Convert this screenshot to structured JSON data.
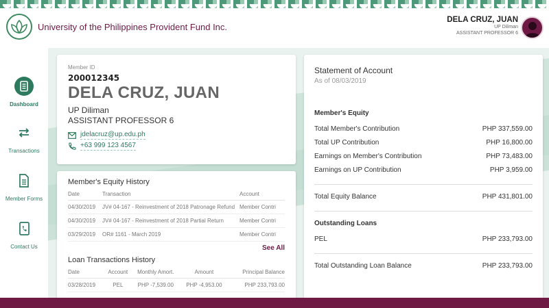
{
  "header": {
    "org_name": "University of the Philippines Provident Fund Inc.",
    "user_name": "DELA CRUZ, JUAN",
    "user_unit": "UP Diliman",
    "user_position": "ASSISTANT PROFESSOR 6"
  },
  "sidebar": {
    "items": [
      {
        "label": "Dashboard",
        "icon": "dashboard-icon",
        "active": true
      },
      {
        "label": "Transactions",
        "icon": "transfer-arrows-icon"
      },
      {
        "label": "Member Forms",
        "icon": "document-icon"
      },
      {
        "label": "Contact Us",
        "icon": "phone-book-icon"
      }
    ]
  },
  "profile": {
    "member_id_label": "Member ID",
    "member_id": "200012345",
    "name": "DELA CRUZ, JUAN",
    "unit": "UP Diliman",
    "position": "ASSISTANT PROFESSOR 6",
    "email": "jdelacruz@up.edu.ph",
    "phone": "+63 999 123 4567"
  },
  "equity_history": {
    "title": "Member's Equity History",
    "columns": [
      "Date",
      "Transaction",
      "Account"
    ],
    "rows": [
      [
        "04/30/2019",
        "JV# 04-167 - Reinvestment of 2018 Patronage Refund",
        "Member Contri"
      ],
      [
        "04/30/2019",
        "JV# 04-167 - Reinvestment of 2018 Partial Return",
        "Member Contri"
      ],
      [
        "03/29/2019",
        "OR# 1161 - March 2019",
        "Member Contri"
      ]
    ],
    "see_all": "See All"
  },
  "loan_history": {
    "title": "Loan Transactions History",
    "columns": [
      "Date",
      "Account",
      "Monthly Amort.",
      "Amount",
      "Principal Balance"
    ],
    "rows": [
      [
        "03/28/2019",
        "PEL",
        "PHP -7,539.00",
        "PHP -4,953.00",
        "PHP 233,793.00"
      ]
    ]
  },
  "statement": {
    "title": "Statement of Account",
    "as_of": "As of 08/03/2019",
    "equity_title": "Member's Equity",
    "equity_rows": [
      {
        "label": "Total Member's Contribution",
        "value": "PHP 337,559.00"
      },
      {
        "label": "Total UP Contribution",
        "value": "PHP 16,800.00"
      },
      {
        "label": "Earnings on Member's Contribution",
        "value": "PHP 73,483.00"
      },
      {
        "label": "Earnings on UP Contribution",
        "value": "PHP 3,959.00"
      }
    ],
    "equity_total_label": "Total Equity Balance",
    "equity_total_value": "PHP 431,801.00",
    "loans_title": "Outstanding Loans",
    "loan_rows": [
      {
        "label": "PEL",
        "value": "PHP 233,793.00"
      }
    ],
    "loans_total_label": "Total Outstanding Loan Balance",
    "loans_total_value": "PHP 233,793.00"
  },
  "colors": {
    "accent_green": "#2d7a5e",
    "brand_maroon": "#6e1a45"
  }
}
